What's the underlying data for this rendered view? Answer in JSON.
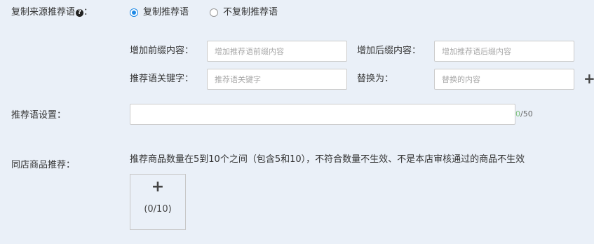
{
  "copy_source": {
    "label": "复制来源推荐语",
    "help_icon": "?",
    "colon": "：",
    "options": [
      {
        "label": "复制推荐语",
        "selected": true
      },
      {
        "label": "不复制推荐语",
        "selected": false
      }
    ]
  },
  "prefix": {
    "label": "增加前缀内容：",
    "placeholder": "增加推荐语前缀内容"
  },
  "suffix": {
    "label": "增加后缀内容：",
    "placeholder": "增加推荐语后缀内容"
  },
  "keyword": {
    "label": "推荐语关键字：",
    "placeholder": "推荐语关键字"
  },
  "replace": {
    "label": "替换为：",
    "placeholder": "替换的内容",
    "add_icon": "+"
  },
  "recommend_setting": {
    "label": "推荐语设置：",
    "value": "",
    "count_current": "0",
    "count_max": "/50"
  },
  "same_store": {
    "label": "同店商品推荐：",
    "hint": "推荐商品数量在5到10个之间（包含5和10），不符合数量不生效、不是本店审核通过的商品不生效",
    "add_icon": "+",
    "count": "(0/10)"
  },
  "colors": {
    "background": "#eaf0f8",
    "radio_accent": "#1e88e5",
    "counter_current": "#7cc17a"
  }
}
